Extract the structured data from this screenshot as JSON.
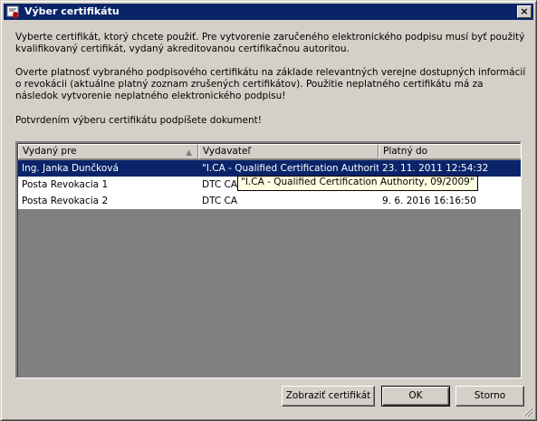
{
  "window": {
    "title": "Výber certifikátu",
    "close_glyph": "×"
  },
  "paragraphs": [
    "Vyberte certifikát, ktorý chcete použiť. Pre vytvorenie zaručeného elektronického podpisu musí byť použitý kvalifikovaný certifikát, vydaný akreditovanou certifikačnou autoritou.",
    "Overte platnosť vybraného podpisového certifikátu na základe relevantných verejne dostupných informácií o revokácii (aktuálne platný zoznam zrušených certifikátov). Použitie neplatného certifikátu má za následok vytvorenie neplatného elektronického podpisu!",
    "Potvrdením výberu certifikátu podpíšete dokument!"
  ],
  "table": {
    "columns": [
      "Vydaný pre",
      "Vydavateľ",
      "Platný do"
    ],
    "sort_indicator": "▲",
    "rows": [
      {
        "issued_to": "Ing. Janka Dunčková",
        "issuer": "\"I.CA - Qualified Certification Authority, ...",
        "valid_to": "23. 11. 2011 12:54:32",
        "selected": true
      },
      {
        "issued_to": "Posta Revokacia 1",
        "issuer": "DTC CA",
        "valid_to": "9",
        "selected": false
      },
      {
        "issued_to": "Posta Revokacia 2",
        "issuer": "DTC CA",
        "valid_to": "9. 6. 2016 16:16:50",
        "selected": false
      }
    ]
  },
  "tooltip": "\"I.CA - Qualified Certification Authority, 09/2009\"",
  "buttons": {
    "show_cert": "Zobraziť certifikát",
    "ok": "OK",
    "cancel": "Storno"
  },
  "colors": {
    "titlebar": "#0a246a",
    "selection": "#0a246a",
    "face": "#d4d0c8",
    "list_bg": "#808080",
    "tooltip_bg": "#ffffe1"
  }
}
